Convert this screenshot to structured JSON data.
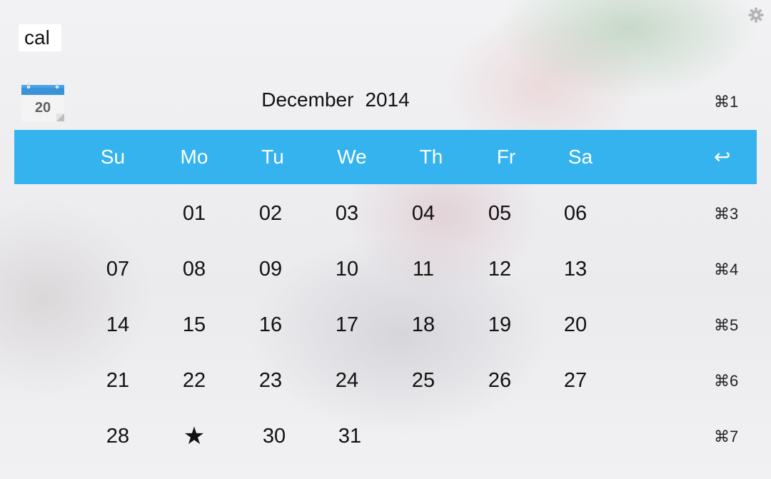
{
  "search": {
    "query": "cal"
  },
  "icons": {
    "settings": "gear-icon",
    "app": "calendar-app-icon",
    "calendar_day_number": "20"
  },
  "header": {
    "month": "December",
    "year": "2014",
    "shortcut": "⌘1"
  },
  "weekdays": [
    "Su",
    "Mo",
    "Tu",
    "We",
    "Th",
    "Fr",
    "Sa"
  ],
  "header_bar": {
    "enter_symbol": "↩",
    "color": "#34b3ee"
  },
  "weeks": [
    {
      "days": [
        "",
        "01",
        "02",
        "03",
        "04",
        "05",
        "06"
      ],
      "shortcut": "⌘3"
    },
    {
      "days": [
        "07",
        "08",
        "09",
        "10",
        "11",
        "12",
        "13"
      ],
      "shortcut": "⌘4"
    },
    {
      "days": [
        "14",
        "15",
        "16",
        "17",
        "18",
        "19",
        "20"
      ],
      "shortcut": "⌘5"
    },
    {
      "days": [
        "21",
        "22",
        "23",
        "24",
        "25",
        "26",
        "27"
      ],
      "shortcut": "⌘6"
    },
    {
      "days": [
        "28",
        "★",
        "30",
        "31",
        "",
        "",
        ""
      ],
      "shortcut": "⌘7"
    }
  ]
}
